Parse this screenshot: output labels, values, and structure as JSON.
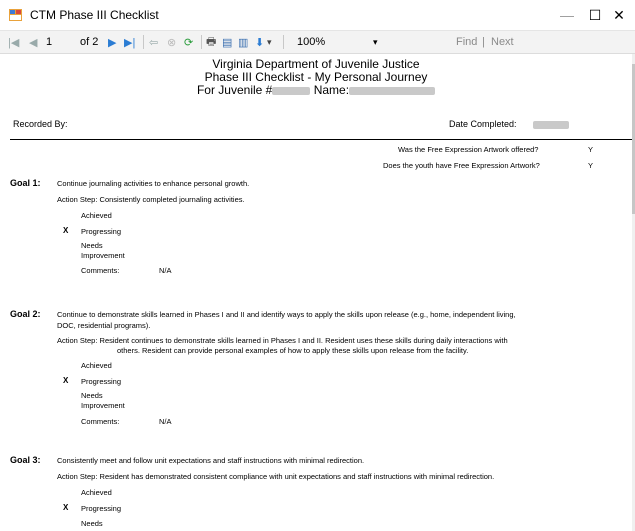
{
  "window": {
    "title": "CTM Phase III Checklist",
    "minimize_glyph": "—",
    "maximize_glyph": "☐",
    "close_glyph": "✕",
    "icon": "app-window-icon"
  },
  "toolbar": {
    "first_glyph": "|◀",
    "prev_glyph": "◀",
    "current_page": "1",
    "of_pages": "of 2",
    "next_glyph": "▶",
    "last_glyph": "▶|",
    "back_glyph": "⇦",
    "stop_glyph": "⊗",
    "refresh_glyph": "⟳",
    "print_glyph": "🖶",
    "layout_glyph": "▤",
    "pagesetup_glyph": "▥",
    "export_glyph": "⬇",
    "zoom": "100%",
    "zoom_arrow": "▾",
    "find_label": "Find",
    "find_sep": "|",
    "next_label": "Next",
    "accent": "#2b7cd3"
  },
  "report": {
    "org": "Virginia Department of Juvenile Justice",
    "subtitle": "Phase III Checklist - My Personal Journey",
    "juvenile_prefix": "For Juvenile #",
    "name_label": "Name:",
    "recorded_by_label": "Recorded By:",
    "date_completed_label": "Date Completed:",
    "questions": [
      {
        "text": "Was the Free Expression Artwork offered?",
        "answer": "Y"
      },
      {
        "text": "Does the youth have Free Expression Artwork?",
        "answer": "Y"
      }
    ],
    "goals": [
      {
        "number": "Goal 1:",
        "text": "Continue journaling activities to enhance personal growth.",
        "action_step_line1": "Action Step: Consistently completed journaling activities.",
        "action_step_line2": "",
        "mark": "X",
        "options": [
          "Achieved",
          "Progressing",
          "Needs",
          "Improvement"
        ],
        "comments_label": "Comments:",
        "comments": "N/A"
      },
      {
        "number": "Goal 2:",
        "text_line1": "Continue to demonstrate skills learned in Phases I and II and identify ways to apply the skills upon release (e.g., home, independent living,",
        "text_line2": "DOC, residential programs).",
        "action_step_line1": "Action Step: Resident continues to demonstrate skills learned in Phases I and II. Resident uses these skills during daily interactions with",
        "action_step_line2": "others. Resident can provide personal examples of how to apply these skills upon release from the facility.",
        "mark": "X",
        "options": [
          "Achieved",
          "Progressing",
          "Needs",
          "Improvement"
        ],
        "comments_label": "Comments:",
        "comments": "N/A"
      },
      {
        "number": "Goal 3:",
        "text": "Consistently meet and follow unit expectations and staff instructions with minimal redirection.",
        "action_step_line1": "Action Step: Resident has demonstrated consistent compliance with unit expectations and staff instructions with minimal redirection.",
        "mark": "X",
        "options": [
          "Achieved",
          "Progressing",
          "Needs"
        ]
      }
    ]
  }
}
